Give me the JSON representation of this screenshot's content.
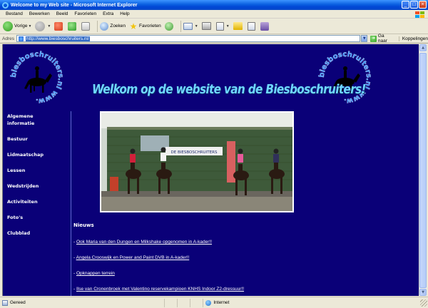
{
  "window": {
    "title": "Welcome to my Web site - Microsoft Internet Explorer",
    "controls": [
      "_",
      "□",
      "×"
    ]
  },
  "menu": [
    "Bestand",
    "Bewerken",
    "Beeld",
    "Favorieten",
    "Extra",
    "Help"
  ],
  "toolbar": {
    "back_label": "Vorige",
    "search_label": "Zoeken",
    "favorites_label": "Favorieten"
  },
  "address": {
    "label": "Adres",
    "url": "http://www.biesboschruiters.nl/",
    "go_label": "Ga naar",
    "links_label": "Koppelingen"
  },
  "page": {
    "logo_text": "biesboschruiters.nl www.",
    "heading": "Welkom op de website van de Biesboschruiters!",
    "nav": [
      {
        "label": "Algemene informatie"
      },
      {
        "label": "Bestuur"
      },
      {
        "label": "Lidmaatschap"
      },
      {
        "label": "Lessen"
      },
      {
        "label": "Wedstrijden"
      },
      {
        "label": "Activiteiten"
      },
      {
        "label": "Foto's"
      },
      {
        "label": "Clubblad"
      }
    ],
    "photo_sign": "DE BIESBOSCHRUITERS",
    "news_title": "Nieuws",
    "news": [
      {
        "prefix": "- ",
        "text": "Ook Maria van den Dungen en Milkshake opgenomen in A-kader!!"
      },
      {
        "prefix": "- ",
        "text": "Angela Crooswijk en Power and Paint DVB in A-kader!!"
      },
      {
        "prefix": "- ",
        "text": "Opknappen terrein"
      },
      {
        "prefix": "- ",
        "text": "Ilse van Cronenbroek met Valentino reservekampioen KNHS Indoor Z2-dressuur!!"
      }
    ]
  },
  "status": {
    "left": "Gereed",
    "zone": "Internet"
  },
  "colors": {
    "page_background": "#0a0078",
    "heading": "#6fd7ff",
    "titlebar": "#0a5fe0"
  }
}
